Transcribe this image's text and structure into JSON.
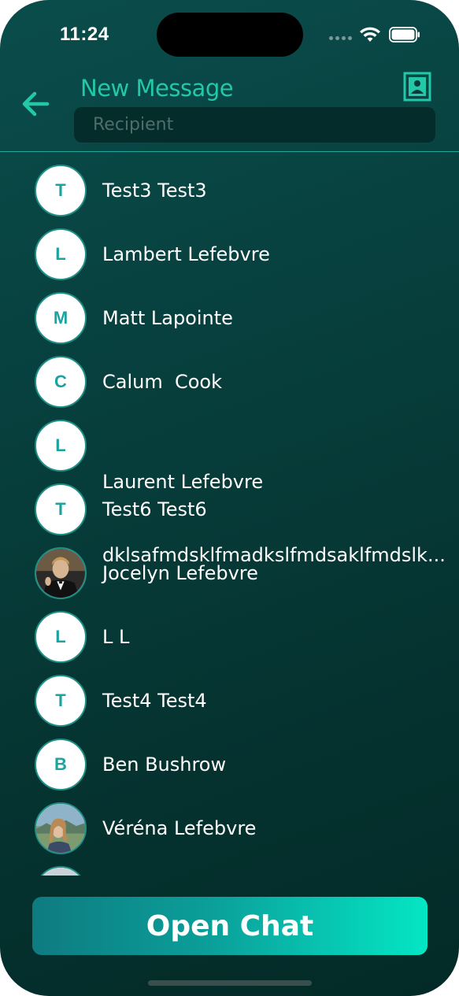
{
  "status_bar": {
    "time": "11:24"
  },
  "header": {
    "title": "New Message",
    "back_icon": "arrow-left-icon",
    "contacts_icon": "contact-book-icon",
    "recipient_placeholder": "Recipient",
    "recipient_value": ""
  },
  "contacts": [
    {
      "initial": "T",
      "name": "Test3 Test3",
      "avatar": "letter"
    },
    {
      "initial": "L",
      "name": "Lambert Lefebvre",
      "avatar": "letter"
    },
    {
      "initial": "M",
      "name": "Matt Lapointe",
      "avatar": "letter"
    },
    {
      "initial": "C",
      "name": "Calum  Cook",
      "avatar": "letter"
    },
    {
      "initial": "L",
      "name": "Laurent Lefebvre",
      "subline": "dklsafmdsklfmadkslfmdsaklfmdslk...",
      "avatar": "letter"
    },
    {
      "initial": "T",
      "name": "Test6 Test6",
      "avatar": "letter"
    },
    {
      "initial": "",
      "name": "Jocelyn Lefebvre",
      "avatar": "photo"
    },
    {
      "initial": "L",
      "name": "L L",
      "avatar": "letter"
    },
    {
      "initial": "T",
      "name": "Test4 Test4",
      "avatar": "letter"
    },
    {
      "initial": "B",
      "name": "Ben Bushrow",
      "avatar": "letter"
    },
    {
      "initial": "",
      "name": "Véréna Lefebvre",
      "avatar": "photo"
    },
    {
      "initial": "",
      "name": "",
      "avatar": "photo"
    }
  ],
  "footer": {
    "open_chat_label": "Open Chat"
  },
  "colors": {
    "accent": "#22c8a8",
    "avatar_letter": "#1aa39f",
    "background_top": "#0a4d4b",
    "background_bottom": "#032a27"
  }
}
